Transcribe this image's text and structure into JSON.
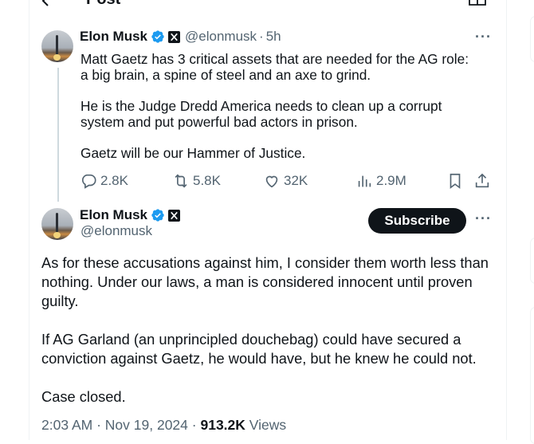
{
  "header": {
    "title": "Post"
  },
  "reply_to": {
    "name": "Elon Musk",
    "handle": "@elonmusk",
    "separator": "·",
    "time": "5h",
    "paragraphs": [
      "Matt Gaetz has 3 critical assets that are needed for the AG role: a big brain, a spine of steel and an axe to grind.",
      "He is the Judge Dredd America needs to clean up a corrupt system and put powerful bad actors in prison.",
      "Gaetz will be our Hammer of Justice."
    ],
    "stats": {
      "replies": "2.8K",
      "reposts": "5.8K",
      "likes": "32K",
      "views": "2.9M"
    }
  },
  "main_post": {
    "name": "Elon Musk",
    "handle": "@elonmusk",
    "subscribe_label": "Subscribe",
    "paragraphs": [
      "As for these accusations against him, I consider them worth less than nothing. Under our laws, a man is considered innocent until proven guilty.",
      "If AG Garland (an unprincipled douchebag) could have secured a conviction against Gaetz, he would have, but he knew he could not.",
      "Case closed."
    ],
    "time": "2:03 AM",
    "date": "Nov 19, 2024",
    "dot": "·",
    "views_count": "913.2K",
    "views_label": "Views"
  },
  "colors": {
    "text": "#0f1419",
    "secondary": "#536471",
    "verified": "#1d9bf0",
    "border": "#eff3f4"
  }
}
